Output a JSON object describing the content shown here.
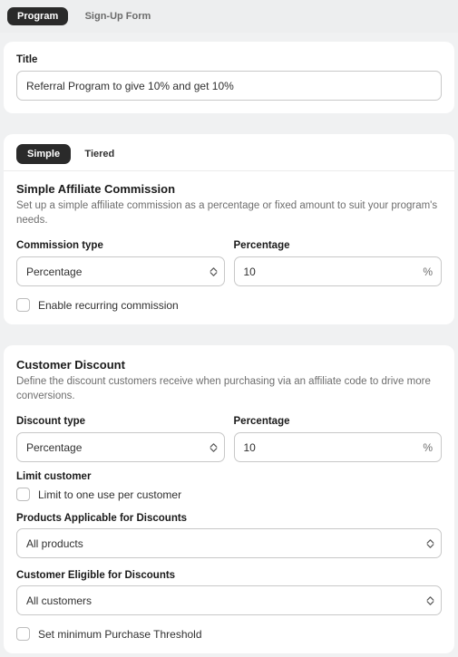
{
  "topTabs": {
    "program": "Program",
    "signup": "Sign-Up Form"
  },
  "titleCard": {
    "label": "Title",
    "value": "Referral Program to give 10% and get 10%"
  },
  "commissionCard": {
    "segment": {
      "simple": "Simple",
      "tiered": "Tiered"
    },
    "heading": "Simple Affiliate Commission",
    "sub": "Set up a simple affiliate commission as a percentage or fixed amount to suit your program's needs.",
    "typeLabel": "Commission type",
    "typeValue": "Percentage",
    "percentLabel": "Percentage",
    "percentValue": "10",
    "percentSuffix": "%",
    "recurring": "Enable recurring commission"
  },
  "discountCard": {
    "heading": "Customer Discount",
    "sub": "Define the discount customers receive when purchasing via an affiliate code to drive more conversions.",
    "typeLabel": "Discount type",
    "typeValue": "Percentage",
    "percentLabel": "Percentage",
    "percentValue": "10",
    "percentSuffix": "%",
    "limitLabel": "Limit customer",
    "limitCheck": "Limit to one use per customer",
    "productsLabel": "Products Applicable for Discounts",
    "productsValue": "All products",
    "eligibleLabel": "Customer Eligible for Discounts",
    "eligibleValue": "All customers",
    "thresholdCheck": "Set minimum Purchase Threshold"
  }
}
